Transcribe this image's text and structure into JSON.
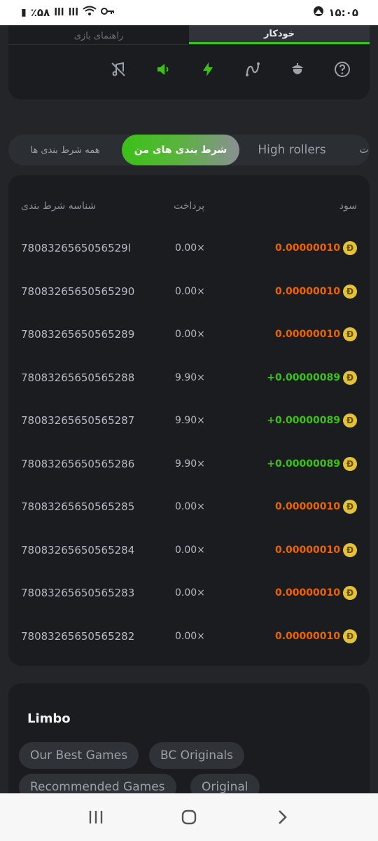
{
  "status_bar": {
    "battery": "٪۵۸",
    "time": "۱۵:۰۵"
  },
  "top_card": {
    "tabs": [
      "راهنمای بازی",
      "خودکار"
    ],
    "icons": [
      "music-off-icon",
      "sound-icon",
      "lightning-icon",
      "curve-icon",
      "acorn-icon",
      "help-icon"
    ]
  },
  "bet_tabs": {
    "all_bets": "همه شرط بندی ها",
    "my_bets": "شرط بندی های من",
    "high_rollers": "High rollers",
    "partial": "ت"
  },
  "bets_table": {
    "headers": {
      "id": "شناسه شرط بندی",
      "payout": "پرداخت",
      "profit": "سود"
    },
    "rows": [
      {
        "id": "7808326565056529l",
        "payout": "0.00×",
        "profit": "0.00000010",
        "result": "loss"
      },
      {
        "id": "78083265650565290",
        "payout": "0.00×",
        "profit": "0.00000010",
        "result": "loss"
      },
      {
        "id": "78083265650565289",
        "payout": "0.00×",
        "profit": "0.00000010",
        "result": "loss"
      },
      {
        "id": "78083265650565288",
        "payout": "9.90×",
        "profit": "+0.00000089",
        "result": "win"
      },
      {
        "id": "78083265650565287",
        "payout": "9.90×",
        "profit": "+0.00000089",
        "result": "win"
      },
      {
        "id": "78083265650565286",
        "payout": "9.90×",
        "profit": "+0.00000089",
        "result": "win"
      },
      {
        "id": "78083265650565285",
        "payout": "0.00×",
        "profit": "0.00000010",
        "result": "loss"
      },
      {
        "id": "78083265650565284",
        "payout": "0.00×",
        "profit": "0.00000010",
        "result": "loss"
      },
      {
        "id": "78083265650565283",
        "payout": "0.00×",
        "profit": "0.00000010",
        "result": "loss"
      },
      {
        "id": "78083265650565282",
        "payout": "0.00×",
        "profit": "0.00000010",
        "result": "loss"
      }
    ],
    "coin_symbol": "Ð"
  },
  "limbo": {
    "title": "Limbo",
    "chips": [
      "Our Best Games",
      "BC Originals",
      "Recommended Games",
      "Original"
    ]
  },
  "colors": {
    "accent_green": "#3bc117",
    "loss_orange": "#ed6300",
    "coin_gold": "#e3c23b"
  }
}
